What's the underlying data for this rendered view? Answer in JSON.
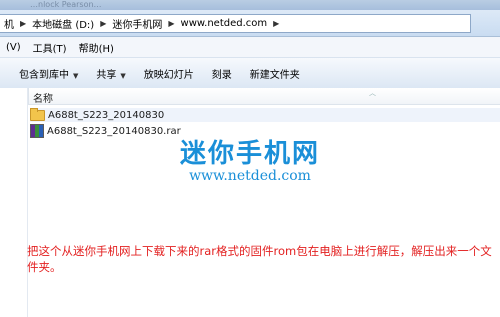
{
  "titlebar": {
    "text": "…nlock Pearson…"
  },
  "address": {
    "crumbs": [
      "机",
      "本地磁盘 (D:)",
      "迷你手机网",
      "www.netded.com"
    ]
  },
  "menu": {
    "items": [
      "(V)",
      "工具(T)",
      "帮助(H)"
    ]
  },
  "toolbar": {
    "buttons": [
      "包含到库中",
      "共享",
      "放映幻灯片",
      "刻录",
      "新建文件夹"
    ]
  },
  "columns": {
    "name": "名称"
  },
  "files": [
    {
      "name": "A688t_S223_20140830",
      "type": "folder"
    },
    {
      "name": "A688t_S223_20140830.rar",
      "type": "rar"
    }
  ],
  "watermark": {
    "title": "迷你手机网",
    "url": "www.netded.com"
  },
  "annotation": "把这个从迷你手机网上下载下来的rar格式的固件rom包在电脑上进行解压，解压出来一个文件夹。",
  "colors": {
    "accent": "#1a8fd8",
    "annotation": "#e32121"
  }
}
